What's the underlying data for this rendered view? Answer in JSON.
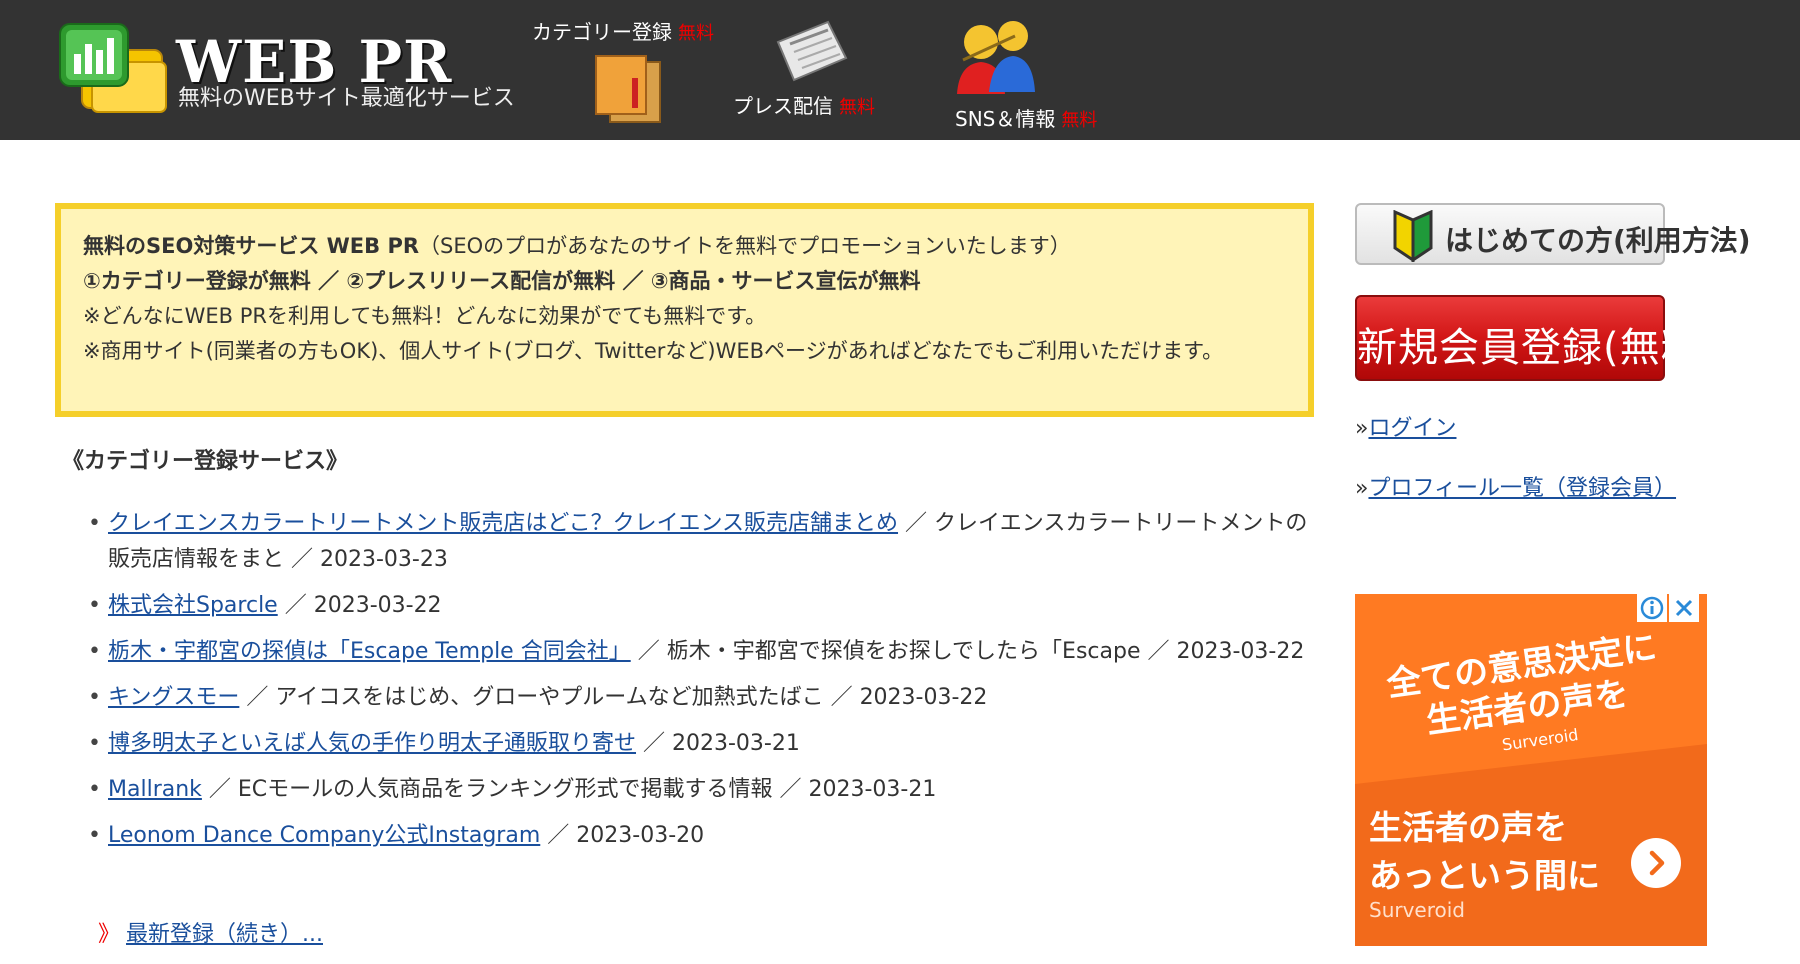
{
  "header": {
    "logo_title": "WEB PR",
    "logo_subtitle": "無料のWEBサイト最適化サービス",
    "nav": [
      {
        "label": "カテゴリー登録",
        "badge": "無料"
      },
      {
        "label": "プレス配信",
        "badge": "無料"
      },
      {
        "label": "SNS＆情報",
        "badge": "無料"
      }
    ]
  },
  "notice": {
    "line1_bold": "無料のSEO対策サービス WEB PR",
    "line1_rest": "（SEOのプロがあなたのサイトを無料でプロモーションいたします）",
    "line2": "①カテゴリー登録が無料 ／ ②プレスリリース配信が無料 ／ ③商品・サービス宣伝が無料",
    "line3": "※どんなにWEB PRを利用しても無料！どんなに効果がでても無料です。",
    "line4": "※商用サイト(同業者の方もOK)、個人サイト(ブログ、Twitterなど)WEBページがあればどなたでもご利用いただけます。"
  },
  "section_title": "《カテゴリー登録サービス》",
  "registrations": [
    {
      "title": "クレイエンスカラートリートメント販売店はどこ？クレイエンス販売店舗まとめ",
      "desc": " ／ クレイエンスカラートリートメントの販売店情報をまと",
      "date": " ／ 2023-03-23"
    },
    {
      "title": "株式会社Sparcle",
      "desc": "",
      "date": " ／ 2023-03-22"
    },
    {
      "title": "栃木・宇都宮の探偵は「Escape Temple 合同会社」",
      "desc": " ／ 栃木・宇都宮で探偵をお探しでしたら「Escape",
      "date": " ／ 2023-03-22"
    },
    {
      "title": "キングスモー",
      "desc": " ／ アイコスをはじめ、グローやプルームなど加熱式たばこ",
      "date": " ／ 2023-03-22"
    },
    {
      "title": "博多明太子といえば人気の手作り明太子通販取り寄せ",
      "desc": "",
      "date": " ／ 2023-03-21"
    },
    {
      "title": "Mallrank",
      "desc": " ／ ECモールの人気商品をランキング形式で掲載する情報",
      "date": " ／ 2023-03-21"
    },
    {
      "title": "Leonom Dance Company公式Instagram",
      "desc": "",
      "date": " ／ 2023-03-20"
    }
  ],
  "more_mark": "》",
  "more_link": "最新登録（続き）...",
  "sidebar": {
    "beginner_button": "はじめての方(利用方法)",
    "register_button": "新規会員登録(無料)",
    "login_prefix": "»",
    "login_link": "ログイン",
    "profiles_prefix": "»",
    "profiles_link": "プロフィール一覧（登録会員）"
  },
  "ad": {
    "headline_line1": "全ての意思決定に",
    "headline_line2": "生活者の声を",
    "brand_small": "Surveroid",
    "body_line1": "生活者の声を",
    "body_line2": "あっという間に",
    "brand": "Surveroid",
    "info_icon": "info-icon",
    "close_icon": "close-icon",
    "accent_color": "#f26a1b"
  },
  "colors": {
    "header_bg": "#333333",
    "notice_bg": "#fff4b8",
    "notice_border": "#f5cf2a",
    "link": "#1a4f9c",
    "free_badge": "#e00000",
    "register_button": "#d21616"
  }
}
